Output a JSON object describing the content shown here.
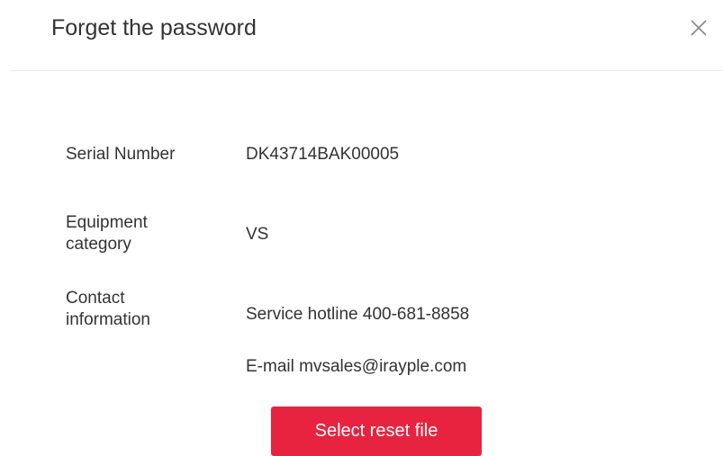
{
  "dialog": {
    "title": "Forget the password",
    "close_icon": "close-icon"
  },
  "fields": {
    "serial_number": {
      "label": "Serial Number",
      "value": "DK43714BAK00005"
    },
    "equipment_category": {
      "label_line1": "Equipment",
      "label_line2": "category",
      "value": "VS"
    },
    "contact_information": {
      "label_line1": "Contact",
      "label_line2": "information",
      "hotline": "Service hotline 400-681-8858",
      "email": "E-mail mvsales@irayple.com"
    }
  },
  "actions": {
    "select_reset_file_label": "Select reset file"
  },
  "colors": {
    "accent": "#e8233f",
    "text": "#333333",
    "divider": "#ececec"
  }
}
